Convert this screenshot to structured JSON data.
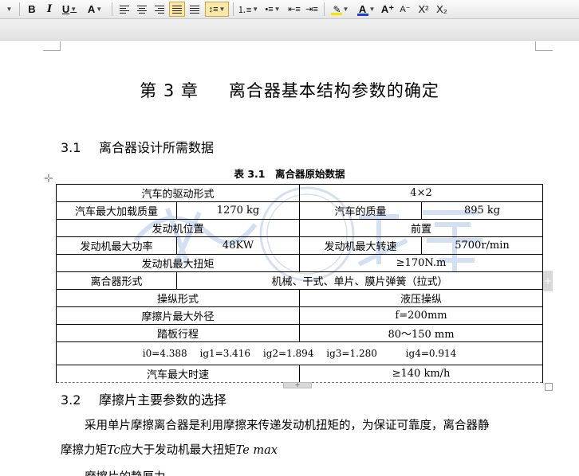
{
  "toolbar": {
    "bold": "B",
    "italic": "I",
    "underline": "U",
    "font_color_a": "A",
    "superscript_label": "X²",
    "subscript_label": "X₂",
    "grow_font": "A⁺",
    "shrink_font": "A⁻",
    "highlight_color": "#f7e400",
    "font_color": "#1c3fd4"
  },
  "document": {
    "chapter_title_num": "第 3 章",
    "chapter_title_text": "离合器基本结构参数的确定",
    "section1_num": "3.1",
    "section1_title": "离合器设计所需数据",
    "table_caption": "表 3.1　离合器原始数据",
    "table": {
      "r1": [
        "汽车的驱动形式",
        "4×2"
      ],
      "r2": [
        "汽车最大加载质量",
        "1270 kg",
        "汽车的质量",
        "895 kg"
      ],
      "r3": [
        "发动机位置",
        "前置"
      ],
      "r4": [
        "发动机最大功率",
        "48KW",
        "发动机最大转速",
        "5700r/min"
      ],
      "r5": [
        "发动机最大扭矩",
        "≥170N.m"
      ],
      "r6": [
        "离合器形式",
        "机械、干式、单片、膜片弹簧（拉式）"
      ],
      "r7": [
        "操纵形式",
        "液压操纵"
      ],
      "r8": [
        "摩擦片最大外径",
        "f=200mm"
      ],
      "r9": [
        "踏板行程",
        "80～150 mm"
      ],
      "r10": [
        "i0=4.388",
        "ig1=3.416",
        "ig2=1.894",
        "ig3=1.280",
        "ig4=0.914"
      ],
      "r11": [
        "汽车最大时速",
        "≥140 km/h"
      ]
    },
    "section2_num": "3.2",
    "section2_title": "摩擦片主要参数的选择",
    "para1_line1": "采用单片摩擦离合器是利用摩擦来传递发动机扭矩的，为保证可靠度，离合器静",
    "para1_line2a": "摩擦力矩",
    "para1_sym1": "Tc",
    "para1_line2b": "应大于发动机最大扭矩",
    "para1_sym2": "Te max",
    "para2_partial": "摩擦片的静厚力"
  },
  "watermark": {
    "color": "#3a78c9"
  }
}
